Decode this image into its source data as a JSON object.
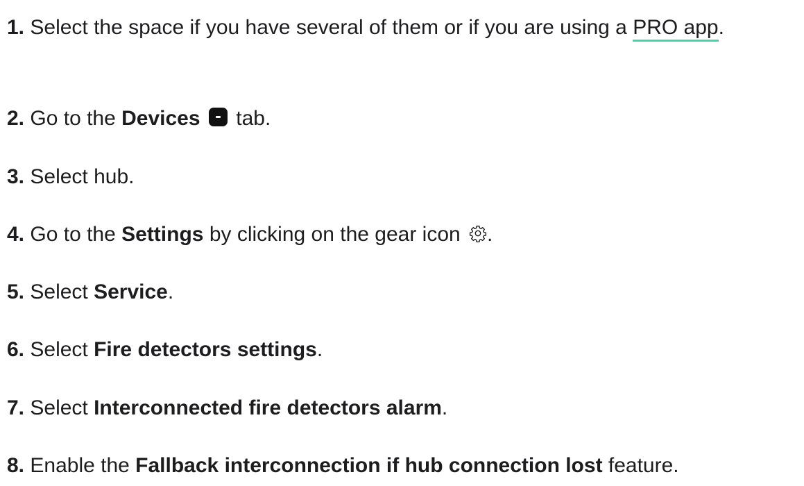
{
  "steps": [
    {
      "num": "1.",
      "pre": "Select the space if you have several of them or if you are using a ",
      "link": "PRO app",
      "post": "."
    },
    {
      "num": "2.",
      "pre": "Go to the ",
      "bold": "Devices",
      "post": " tab.",
      "icon": "devices-icon"
    },
    {
      "num": "3.",
      "pre": "Select hub."
    },
    {
      "num": "4.",
      "pre": "Go to the ",
      "bold": "Settings",
      "mid": " by clicking on the gear icon ",
      "post": ".",
      "icon": "gear-icon"
    },
    {
      "num": "5.",
      "pre": "Select ",
      "bold": "Service",
      "post": "."
    },
    {
      "num": "6.",
      "pre": "Select ",
      "bold": "Fire detectors settings",
      "post": "."
    },
    {
      "num": "7.",
      "pre": "Select ",
      "bold": "Interconnected fire detectors alarm",
      "post": "."
    },
    {
      "num": "8.",
      "pre": "Enable the ",
      "bold": "Fallback interconnection if hub connection lost",
      "post": " feature."
    }
  ],
  "colors": {
    "link_underline": "#3fd6a8",
    "text": "#1d1d1f"
  }
}
